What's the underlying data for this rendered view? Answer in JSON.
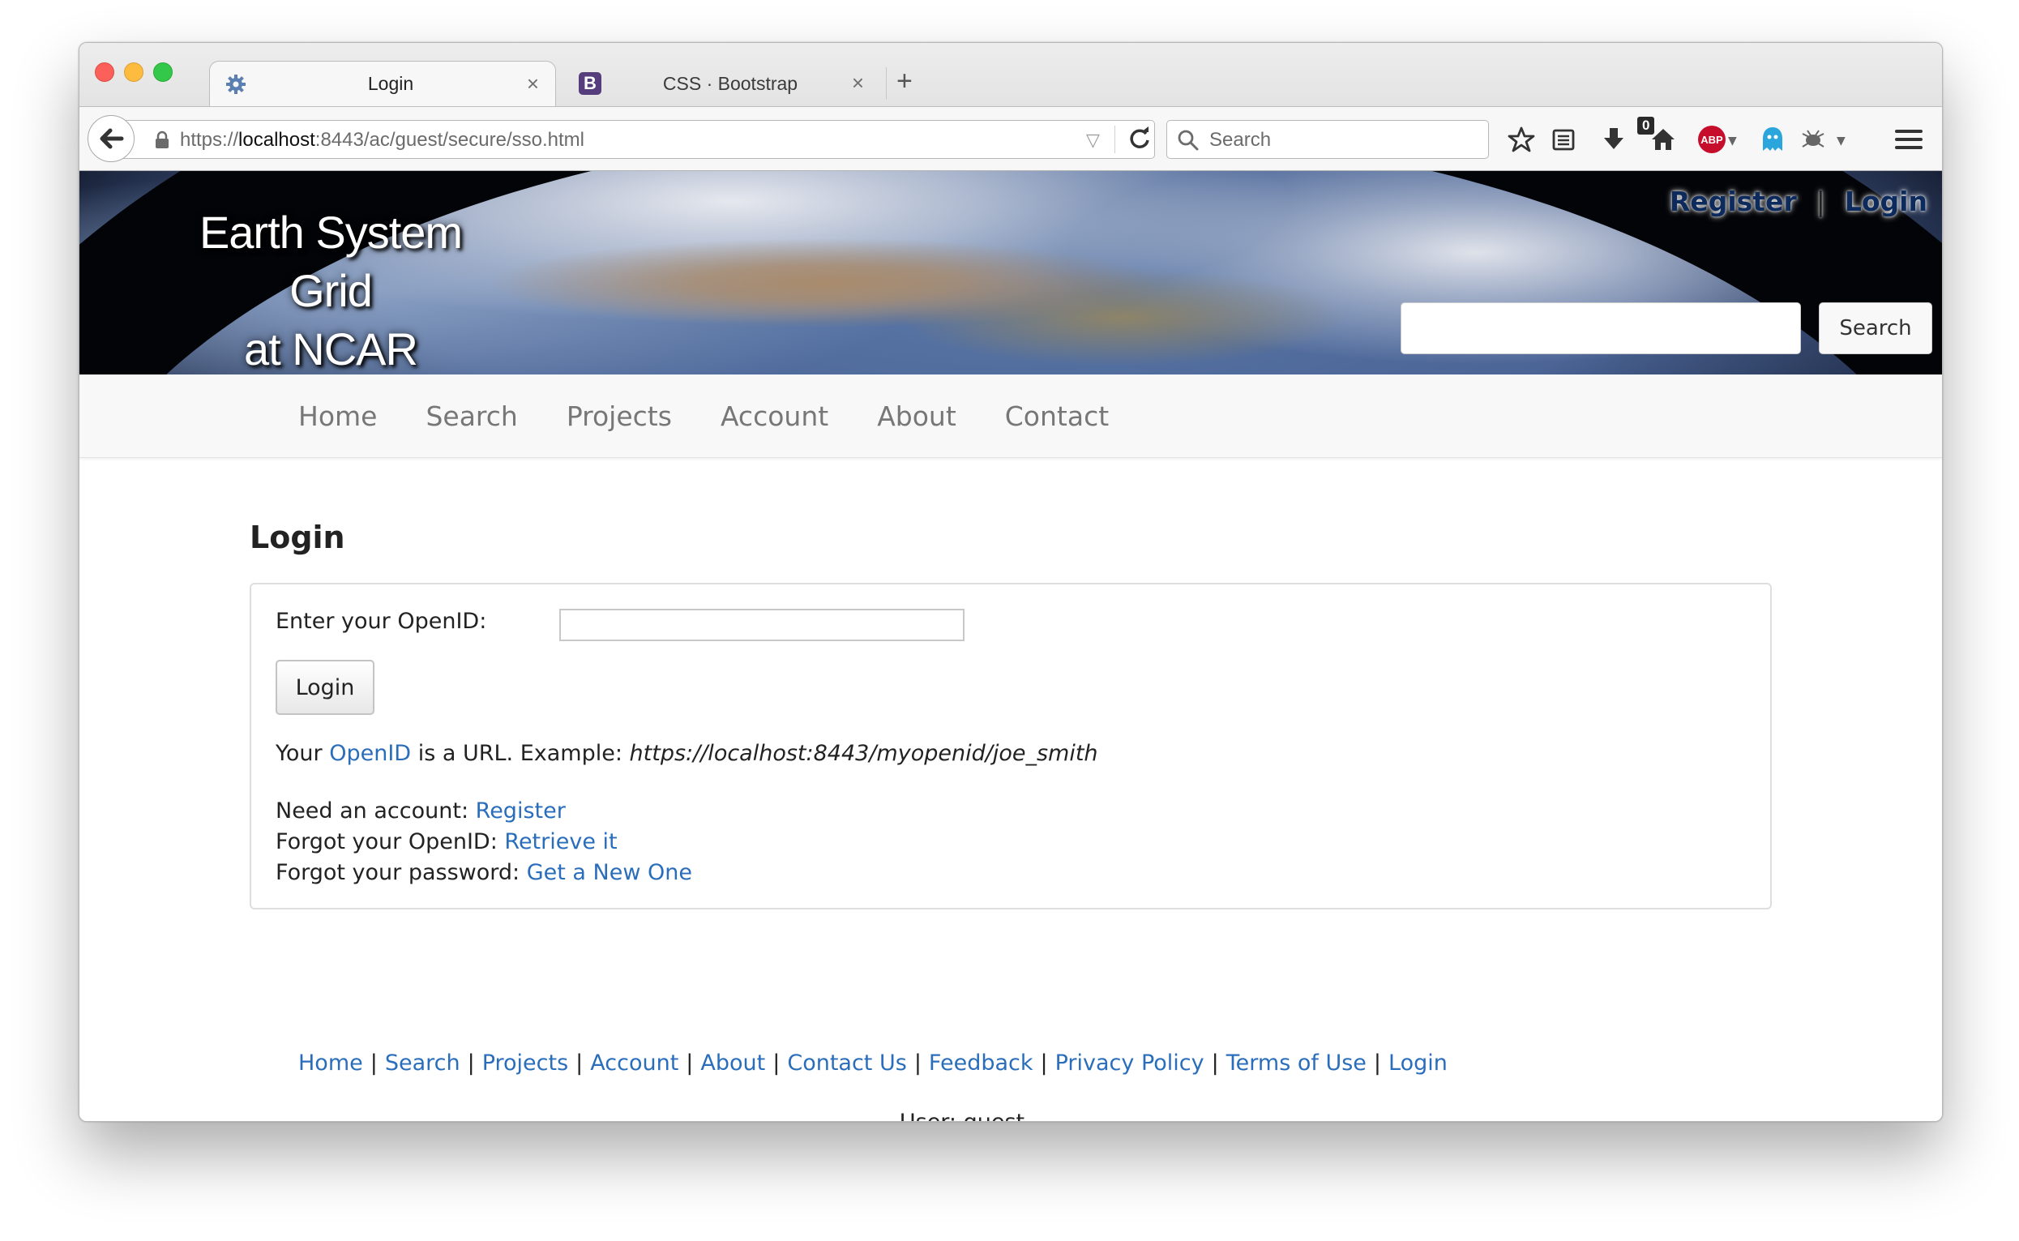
{
  "browser": {
    "tabs": [
      {
        "title": "Login",
        "icon": "gear-icon",
        "active": true
      },
      {
        "title": "CSS · Bootstrap",
        "icon": "bootstrap-icon",
        "icon_text": "B",
        "active": false
      }
    ],
    "new_tab_symbol": "+",
    "close_symbol": "×",
    "url_prefix": "https://",
    "url_host": "localhost",
    "url_rest": ":8443/ac/guest/secure/sso.html",
    "search_placeholder": "Search",
    "ghost_badge": "0",
    "abp_text": "ABP"
  },
  "site": {
    "title_line1": "Earth System Grid",
    "title_line2": "at NCAR",
    "top_links": {
      "register": "Register",
      "separator": "|",
      "login": "Login"
    },
    "search_button": "Search",
    "nav": [
      "Home",
      "Search",
      "Projects",
      "Account",
      "About",
      "Contact"
    ]
  },
  "login": {
    "heading": "Login",
    "openid_label": "Enter your OpenID:",
    "openid_value": "",
    "button": "Login",
    "info_prefix": "Your ",
    "info_link": "OpenID",
    "info_middle": " is a URL. Example: ",
    "info_example": "https://localhost:8443/myopenid/joe_smith",
    "need_account_label": "Need an account: ",
    "need_account_link": "Register",
    "forgot_openid_label": "Forgot your OpenID: ",
    "forgot_openid_link": "Retrieve it",
    "forgot_password_label": "Forgot your password: ",
    "forgot_password_link": "Get a New One"
  },
  "footer": {
    "links": [
      "Home",
      "Search",
      "Projects",
      "Account",
      "About",
      "Contact Us",
      "Feedback",
      "Privacy Policy",
      "Terms of Use",
      "Login"
    ],
    "separator": "|",
    "user_text": "User: guest"
  },
  "colors": {
    "link": "#2a6ebb",
    "top_link": "#0d2a5c",
    "nav_text": "#777777"
  }
}
